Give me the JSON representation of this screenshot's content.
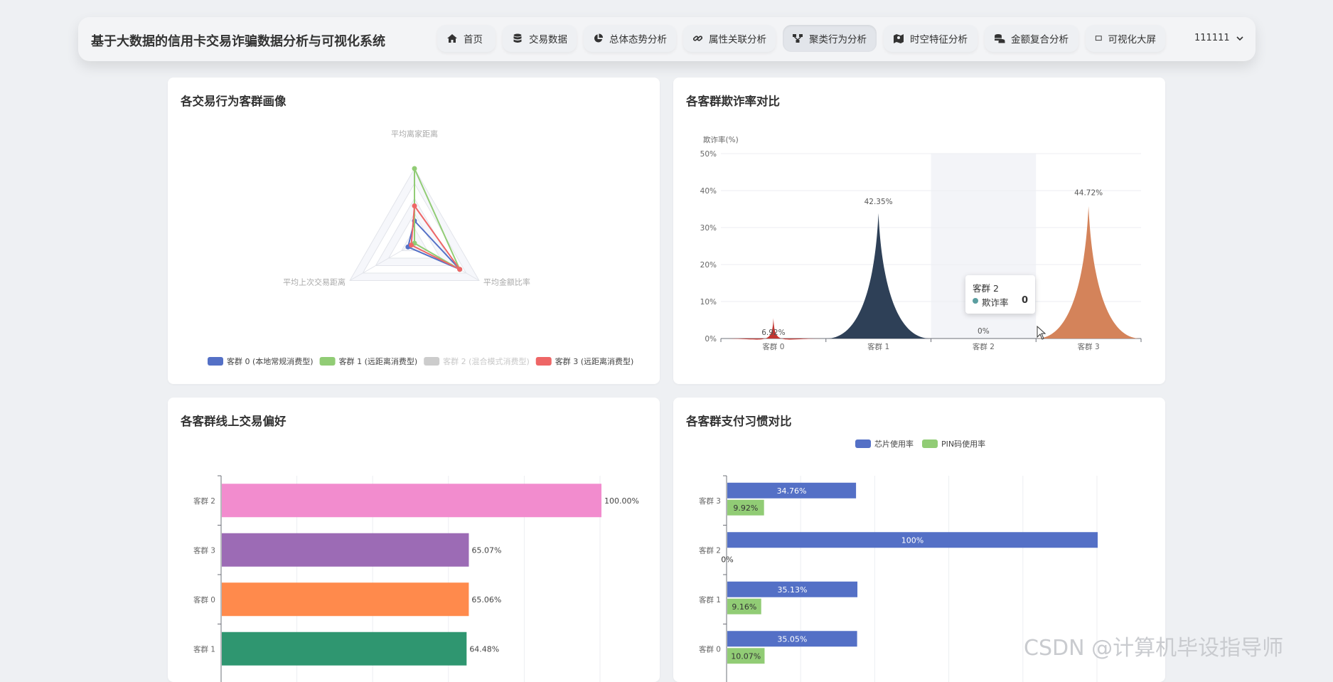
{
  "app": {
    "title": "基于大数据的信用卡交易诈骗数据分析与可视化系统"
  },
  "nav": [
    {
      "label": "首页",
      "icon": "home-icon",
      "active": false
    },
    {
      "label": "交易数据",
      "icon": "database-icon",
      "active": false
    },
    {
      "label": "总体态势分析",
      "icon": "pie-icon",
      "active": false
    },
    {
      "label": "属性关联分析",
      "icon": "link-icon",
      "active": false
    },
    {
      "label": "聚类行为分析",
      "icon": "cluster-icon",
      "active": true
    },
    {
      "label": "时空特征分析",
      "icon": "map-icon",
      "active": false
    },
    {
      "label": "金额复合分析",
      "icon": "coins-icon",
      "active": false
    },
    {
      "label": "可视化大屏",
      "icon": "screen-icon",
      "active": false
    }
  ],
  "user": {
    "name": "111111"
  },
  "panels": {
    "radar": {
      "title": "各交易行为客群画像"
    },
    "fraud": {
      "title": "各客群欺诈率对比"
    },
    "online": {
      "title": "各客群线上交易偏好"
    },
    "payment": {
      "title": "各客群支付习惯对比"
    }
  },
  "tooltip": {
    "title": "客群 2",
    "series": "欺诈率",
    "value": "0"
  },
  "watermark": "CSDN @计算机毕设指导师",
  "colors": {
    "blue": "#5470c6",
    "green": "#91cc75",
    "grey": "#cccccc",
    "red": "#ee6666",
    "navy": "#2e4057",
    "brick": "#c23531",
    "peach": "#d4835a",
    "pink": "#f28cce",
    "purple": "#9c6bb5",
    "orange": "#ff8a4c",
    "teal": "#2f9670"
  },
  "chart_data": [
    {
      "type": "radar",
      "indicators": [
        "平均离家距离",
        "平均金额比率",
        "平均上次交易距离"
      ],
      "series": [
        {
          "name": "客群 0 (本地常规消费型)",
          "values": [
            0.3,
            0.7,
            0.1
          ],
          "color": "#5470c6",
          "enabled": true
        },
        {
          "name": "客群 1 (远距离消费型)",
          "values": [
            1.0,
            0.7,
            0.0
          ],
          "color": "#91cc75",
          "enabled": true
        },
        {
          "name": "客群 2 (混合模式消费型)",
          "values": [
            0,
            0,
            0
          ],
          "color": "#cccccc",
          "enabled": false
        },
        {
          "name": "客群 3 (远距离消费型)",
          "values": [
            0.5,
            0.7,
            0.05
          ],
          "color": "#ee6666",
          "enabled": true
        }
      ],
      "legend_position": "bottom"
    },
    {
      "type": "bar",
      "ylabel": "欺诈率(%)",
      "categories": [
        "客群 0",
        "客群 1",
        "客群 2",
        "客群 3"
      ],
      "values": [
        6.92,
        42.35,
        0,
        44.72
      ],
      "labels": [
        "6.92%",
        "42.35%",
        "0%",
        "44.72%"
      ],
      "colors": [
        "#c23531",
        "#2e4057",
        "#cccccc",
        "#d4835a"
      ],
      "yticks": [
        "0%",
        "10%",
        "20%",
        "30%",
        "40%",
        "50%"
      ],
      "ylim": [
        0,
        50
      ],
      "highlighted_category": "客群 2"
    },
    {
      "type": "bar",
      "orientation": "horizontal",
      "categories": [
        "客群 2",
        "客群 3",
        "客群 0",
        "客群 1"
      ],
      "values": [
        100.0,
        65.07,
        65.06,
        64.48
      ],
      "labels": [
        "100.00%",
        "65.07%",
        "65.06%",
        "64.48%"
      ],
      "colors": [
        "#f28cce",
        "#9c6bb5",
        "#ff8a4c",
        "#2f9670"
      ],
      "xlim": [
        0,
        100
      ]
    },
    {
      "type": "bar",
      "orientation": "horizontal",
      "categories": [
        "客群 3",
        "客群 2",
        "客群 1",
        "客群 0"
      ],
      "series": [
        {
          "name": "芯片使用率",
          "values": [
            34.76,
            100,
            35.13,
            35.05
          ],
          "labels": [
            "34.76%",
            "100%",
            "35.13%",
            "35.05%"
          ],
          "color": "#5470c6"
        },
        {
          "name": "PIN码使用率",
          "values": [
            9.92,
            0,
            9.16,
            10.07
          ],
          "labels": [
            "9.92%",
            "0%",
            "9.16%",
            "10.07%"
          ],
          "color": "#91cc75"
        }
      ],
      "xlim": [
        0,
        100
      ],
      "legend_position": "top"
    }
  ]
}
